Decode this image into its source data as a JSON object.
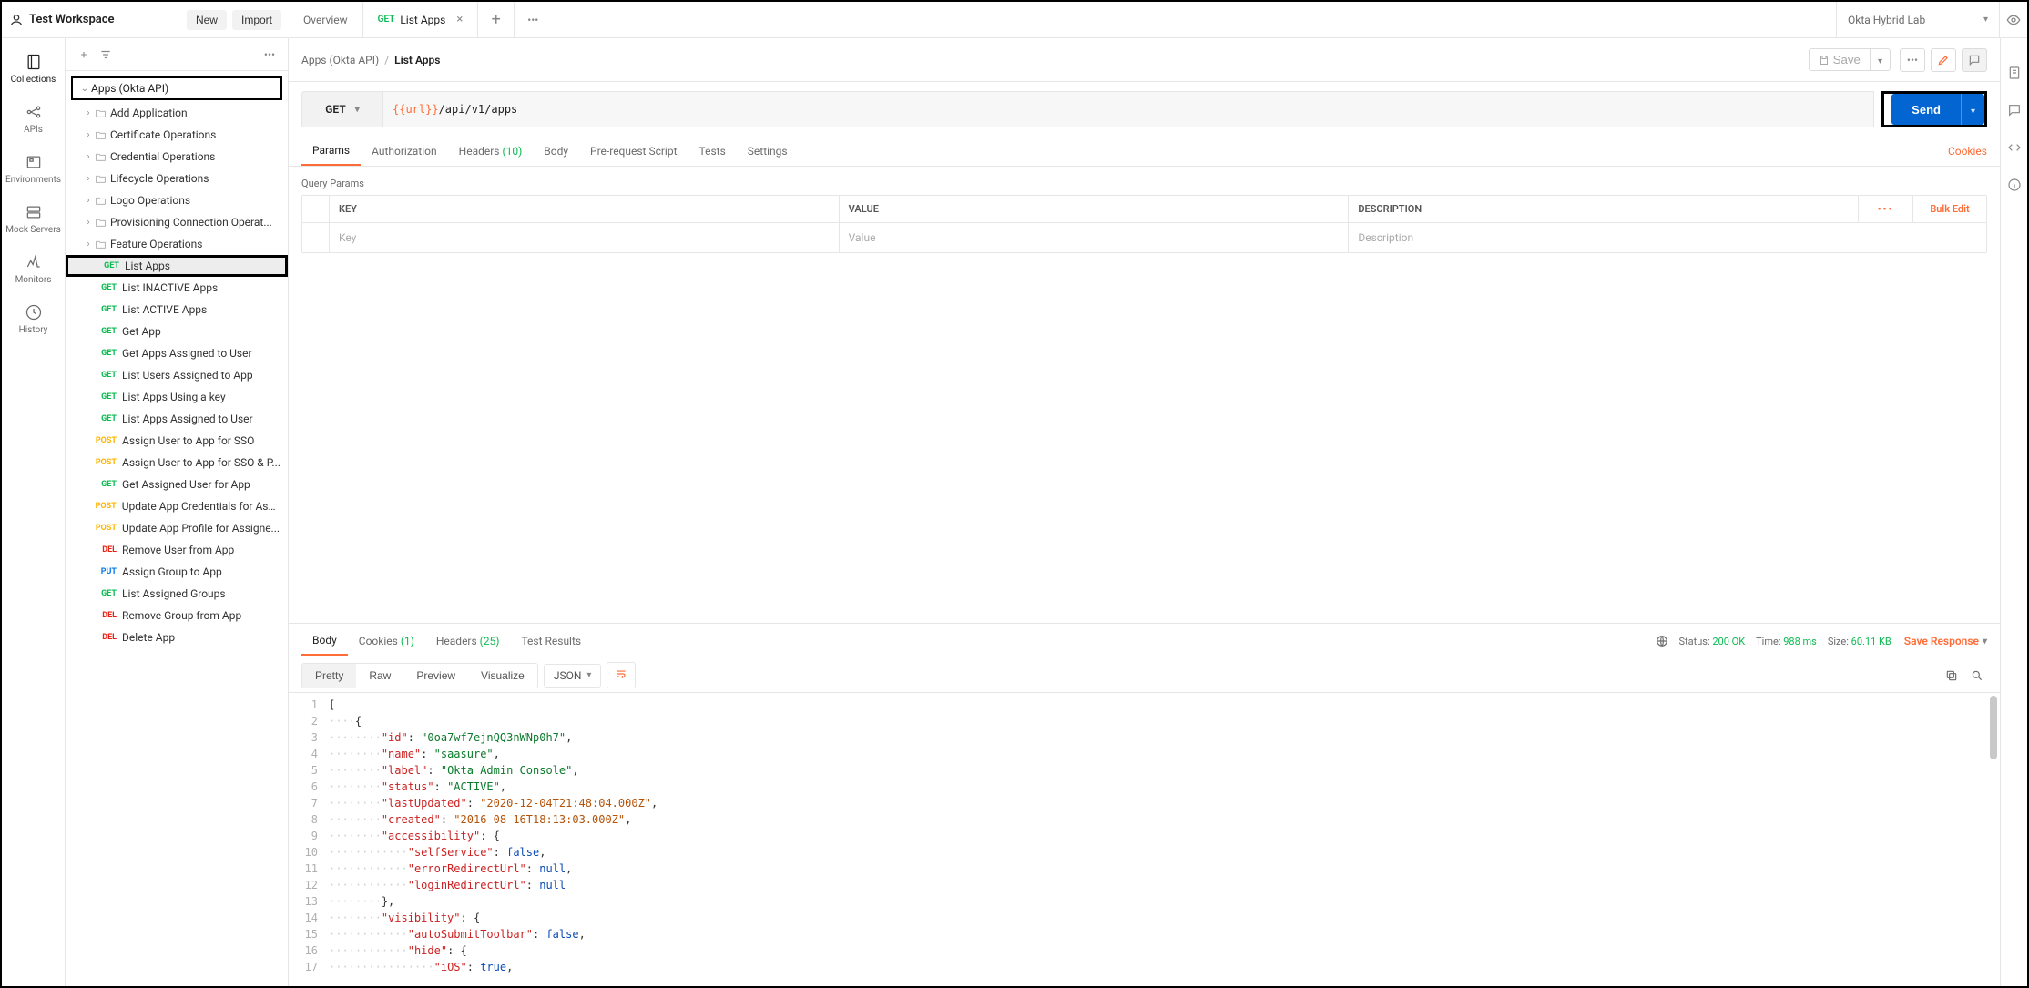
{
  "workspace": {
    "name": "Test Workspace",
    "new_btn": "New",
    "import_btn": "Import"
  },
  "rail": {
    "collections": "Collections",
    "apis": "APIs",
    "environments": "Environments",
    "mock": "Mock Servers",
    "monitors": "Monitors",
    "history": "History"
  },
  "collection": {
    "name": "Apps (Okta API)",
    "folders": [
      "Add Application",
      "Certificate Operations",
      "Credential Operations",
      "Lifecycle Operations",
      "Logo Operations",
      "Provisioning Connection Operat...",
      "Feature Operations"
    ],
    "requests": [
      {
        "method": "GET",
        "label": "List Apps"
      },
      {
        "method": "GET",
        "label": "List INACTIVE Apps"
      },
      {
        "method": "GET",
        "label": "List ACTIVE Apps"
      },
      {
        "method": "GET",
        "label": "Get App"
      },
      {
        "method": "GET",
        "label": "Get Apps Assigned to User"
      },
      {
        "method": "GET",
        "label": "List Users Assigned to App"
      },
      {
        "method": "GET",
        "label": "List Apps Using a key"
      },
      {
        "method": "GET",
        "label": "List Apps Assigned to User"
      },
      {
        "method": "POST",
        "label": "Assign User to App for SSO"
      },
      {
        "method": "POST",
        "label": "Assign User to App for SSO & P..."
      },
      {
        "method": "GET",
        "label": "Get Assigned User for App"
      },
      {
        "method": "POST",
        "label": "Update App Credentials for Ass..."
      },
      {
        "method": "POST",
        "label": "Update App Profile for Assigne..."
      },
      {
        "method": "DEL",
        "label": "Remove User from App"
      },
      {
        "method": "PUT",
        "label": "Assign Group to App"
      },
      {
        "method": "GET",
        "label": "List Assigned Groups"
      },
      {
        "method": "DEL",
        "label": "Remove Group from App"
      },
      {
        "method": "DEL",
        "label": "Delete App"
      }
    ]
  },
  "tabs": {
    "overview": "Overview",
    "active_method": "GET",
    "active_label": "List Apps"
  },
  "environment": "Okta Hybrid Lab",
  "breadcrumb": {
    "parent": "Apps (Okta API)",
    "leaf": "List Apps",
    "save": "Save"
  },
  "request": {
    "method": "GET",
    "url_var": "{{url}}",
    "url_path": "/api/v1/apps",
    "send": "Send",
    "tabs": {
      "params": "Params",
      "auth": "Authorization",
      "headers": "Headers",
      "headers_count": "(10)",
      "body": "Body",
      "prereq": "Pre-request Script",
      "tests": "Tests",
      "settings": "Settings"
    },
    "cookies_link": "Cookies",
    "qp_title": "Query Params",
    "qp_headers": {
      "key": "KEY",
      "value": "VALUE",
      "desc": "DESCRIPTION",
      "bulk": "Bulk Edit"
    },
    "qp_placeholder": {
      "key": "Key",
      "value": "Value",
      "desc": "Description"
    }
  },
  "response": {
    "tabs": {
      "body": "Body",
      "cookies": "Cookies",
      "cookies_count": "(1)",
      "headers": "Headers",
      "headers_count": "(25)",
      "tests": "Test Results"
    },
    "status_label": "Status:",
    "status_code": "200 OK",
    "time_label": "Time:",
    "time_value": "988 ms",
    "size_label": "Size:",
    "size_value": "60.11 KB",
    "save": "Save Response",
    "views": {
      "pretty": "Pretty",
      "raw": "Raw",
      "preview": "Preview",
      "visualize": "Visualize",
      "format": "JSON"
    },
    "json_lines": [
      {
        "n": 1,
        "indent": 0,
        "tokens": [
          {
            "t": "p",
            "v": "["
          }
        ]
      },
      {
        "n": 2,
        "indent": 1,
        "tokens": [
          {
            "t": "p",
            "v": "{"
          }
        ]
      },
      {
        "n": 3,
        "indent": 2,
        "tokens": [
          {
            "t": "k",
            "v": "\"id\""
          },
          {
            "t": "p",
            "v": ": "
          },
          {
            "t": "s",
            "v": "\"0oa7wf7ejnQQ3nWNp0h7\""
          },
          {
            "t": "p",
            "v": ","
          }
        ]
      },
      {
        "n": 4,
        "indent": 2,
        "tokens": [
          {
            "t": "k",
            "v": "\"name\""
          },
          {
            "t": "p",
            "v": ": "
          },
          {
            "t": "s",
            "v": "\"saasure\""
          },
          {
            "t": "p",
            "v": ","
          }
        ]
      },
      {
        "n": 5,
        "indent": 2,
        "tokens": [
          {
            "t": "k",
            "v": "\"label\""
          },
          {
            "t": "p",
            "v": ": "
          },
          {
            "t": "s",
            "v": "\"Okta Admin Console\""
          },
          {
            "t": "p",
            "v": ","
          }
        ]
      },
      {
        "n": 6,
        "indent": 2,
        "tokens": [
          {
            "t": "k",
            "v": "\"status\""
          },
          {
            "t": "p",
            "v": ": "
          },
          {
            "t": "s",
            "v": "\"ACTIVE\""
          },
          {
            "t": "p",
            "v": ","
          }
        ]
      },
      {
        "n": 7,
        "indent": 2,
        "tokens": [
          {
            "t": "k",
            "v": "\"lastUpdated\""
          },
          {
            "t": "p",
            "v": ": "
          },
          {
            "t": "date",
            "v": "\"2020-12-04T21:48:04.000Z\""
          },
          {
            "t": "p",
            "v": ","
          }
        ]
      },
      {
        "n": 8,
        "indent": 2,
        "tokens": [
          {
            "t": "k",
            "v": "\"created\""
          },
          {
            "t": "p",
            "v": ": "
          },
          {
            "t": "date",
            "v": "\"2016-08-16T18:13:03.000Z\""
          },
          {
            "t": "p",
            "v": ","
          }
        ]
      },
      {
        "n": 9,
        "indent": 2,
        "tokens": [
          {
            "t": "k",
            "v": "\"accessibility\""
          },
          {
            "t": "p",
            "v": ": {"
          }
        ]
      },
      {
        "n": 10,
        "indent": 3,
        "tokens": [
          {
            "t": "k",
            "v": "\"selfService\""
          },
          {
            "t": "p",
            "v": ": "
          },
          {
            "t": "b",
            "v": "false"
          },
          {
            "t": "p",
            "v": ","
          }
        ]
      },
      {
        "n": 11,
        "indent": 3,
        "tokens": [
          {
            "t": "k",
            "v": "\"errorRedirectUrl\""
          },
          {
            "t": "p",
            "v": ": "
          },
          {
            "t": "b",
            "v": "null"
          },
          {
            "t": "p",
            "v": ","
          }
        ]
      },
      {
        "n": 12,
        "indent": 3,
        "tokens": [
          {
            "t": "k",
            "v": "\"loginRedirectUrl\""
          },
          {
            "t": "p",
            "v": ": "
          },
          {
            "t": "b",
            "v": "null"
          }
        ]
      },
      {
        "n": 13,
        "indent": 2,
        "tokens": [
          {
            "t": "p",
            "v": "},"
          }
        ]
      },
      {
        "n": 14,
        "indent": 2,
        "tokens": [
          {
            "t": "k",
            "v": "\"visibility\""
          },
          {
            "t": "p",
            "v": ": {"
          }
        ]
      },
      {
        "n": 15,
        "indent": 3,
        "tokens": [
          {
            "t": "k",
            "v": "\"autoSubmitToolbar\""
          },
          {
            "t": "p",
            "v": ": "
          },
          {
            "t": "b",
            "v": "false"
          },
          {
            "t": "p",
            "v": ","
          }
        ]
      },
      {
        "n": 16,
        "indent": 3,
        "tokens": [
          {
            "t": "k",
            "v": "\"hide\""
          },
          {
            "t": "p",
            "v": ": {"
          }
        ]
      },
      {
        "n": 17,
        "indent": 4,
        "tokens": [
          {
            "t": "k",
            "v": "\"iOS\""
          },
          {
            "t": "p",
            "v": ": "
          },
          {
            "t": "b",
            "v": "true"
          },
          {
            "t": "p",
            "v": ","
          }
        ]
      }
    ]
  }
}
